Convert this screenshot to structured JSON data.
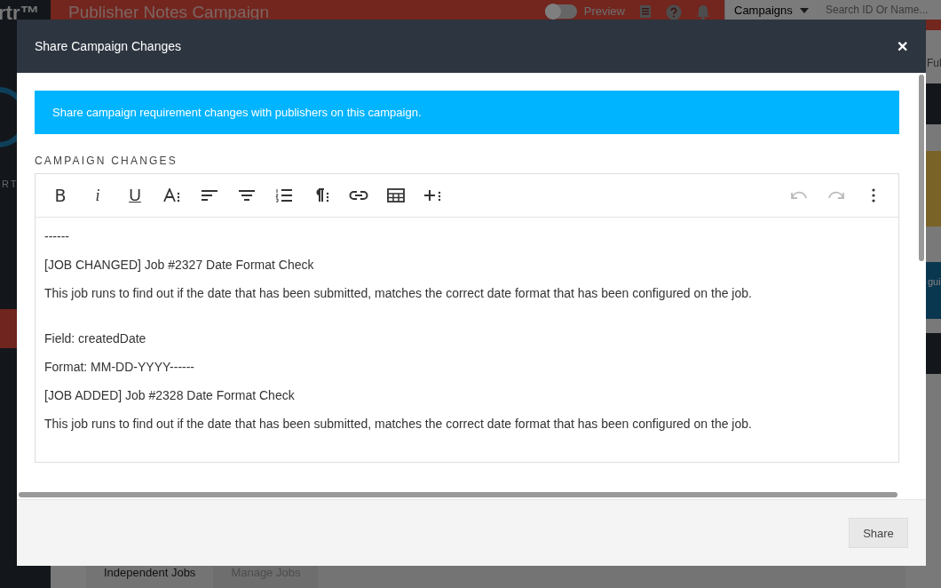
{
  "background": {
    "logo": "rtr™",
    "brand": "RT",
    "title": "Publisher Notes Campaign",
    "preview": {
      "label": "Preview",
      "on": false
    },
    "campaigns_menu": "Campaigns",
    "search": {
      "placeholder": "Search ID Or Name..."
    },
    "side_texts": [
      "Ful",
      "gui"
    ],
    "tabs": [
      {
        "label": "Independent Jobs",
        "selected": true
      },
      {
        "label": "Manage Jobs",
        "selected": false
      }
    ]
  },
  "dialog": {
    "title": "Share Campaign Changes",
    "close": "✕",
    "notice": "Share campaign requirement changes with publishers on this campaign.",
    "section_label": "CAMPAIGN CHANGES",
    "toolbar": [
      {
        "kind": "bold",
        "label": "B",
        "disabled": false
      },
      {
        "kind": "italic",
        "label": "i",
        "disabled": false
      },
      {
        "kind": "underline",
        "label": "U",
        "disabled": false
      },
      {
        "kind": "font-size",
        "disabled": false
      },
      {
        "kind": "align-left",
        "disabled": false
      },
      {
        "kind": "align-center",
        "disabled": false
      },
      {
        "kind": "ordered-list",
        "disabled": false
      },
      {
        "kind": "paragraph",
        "disabled": false
      },
      {
        "kind": "link",
        "disabled": false
      },
      {
        "kind": "table",
        "disabled": false
      },
      {
        "kind": "insert",
        "disabled": false
      },
      {
        "kind": "undo",
        "disabled": true
      },
      {
        "kind": "redo",
        "disabled": true
      },
      {
        "kind": "more",
        "disabled": false
      }
    ],
    "content": [
      [
        "------",
        "[JOB CHANGED] Job #2327 Date Format Check",
        "This job runs to find out if the date that has been submitted, matches the correct date format that has been configured on the job."
      ],
      [
        "Field: createdDate",
        "Format: MM-DD-YYYY------",
        "[JOB ADDED] Job #2328 Date Format Check",
        "This job runs to find out if the date that has been submitted, matches the correct date format that has been configured on the job."
      ]
    ],
    "share_button": "Share"
  }
}
